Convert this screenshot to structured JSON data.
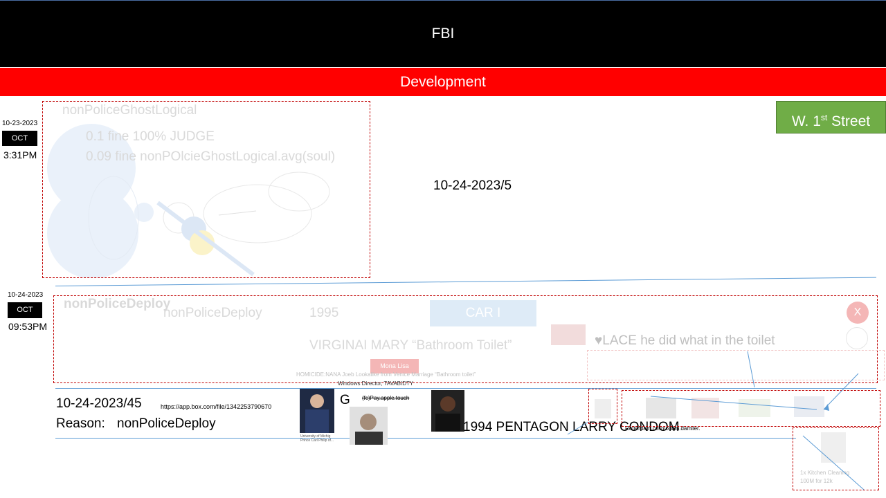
{
  "header": {
    "title": "FBI"
  },
  "banner": {
    "title": "Development"
  },
  "street_button": {
    "label": "W. 1",
    "sup": "st",
    "suffix": " Street"
  },
  "entry1": {
    "date": "10-23-2023",
    "month": "OCT",
    "time": "3:31PM",
    "panel_title": "nonPoliceGhostLogical",
    "line1": "0.1 fine 100% JUDGE",
    "line2": "0.09 fine nonPOlcieGhostLogical.avg(soul)",
    "center_date": "10-24-2023/5"
  },
  "entry2": {
    "date": "10-24-2023",
    "month": "OCT",
    "time": "09:53PM",
    "panel_title": "nonPoliceDeploy",
    "sub_title": "nonPoliceDeploy",
    "year": "1995",
    "car_label": "CAR I",
    "virginia": "VIRGINAI MARY “Bathroom Toilet”",
    "lace": "♥LACE he did what in the toilet",
    "mona": "Mona Lisa",
    "homicide": "HOMICIDE:NANA Joeb Lookalike from Venice Marriage “Bathroom toilet”",
    "close": "X"
  },
  "footer": {
    "date": "10-24-2023/45",
    "url": "https://app.box.com/file/1342253790670",
    "reason_label": "Reason:",
    "reason_value": "nonPoliceDeploy",
    "g_letter": "G",
    "windows": "Windows Director, TAVABIDTY",
    "pay": "(fc)Pay.apple.touch",
    "pentagon": "1994 PENTAGON LARRY CONDOM",
    "tiny_right": "Rotterdam.cosmo.lbm.damller.",
    "caption1": "University of Michig",
    "caption2": "Prince Carl Philip of...",
    "kitchen1": "1x Kitchen Cleaning",
    "kitchen2": "100M for 12k"
  }
}
